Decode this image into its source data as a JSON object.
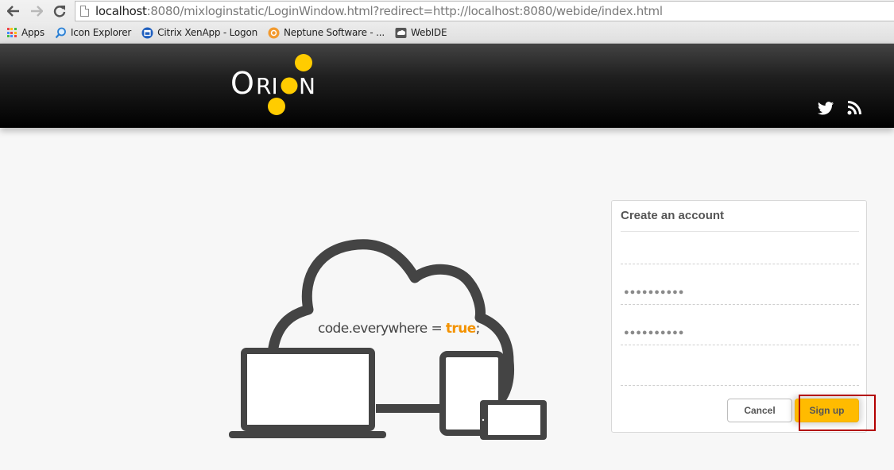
{
  "browser": {
    "url_host": "localhost",
    "url_rest": ":8080/mixloginstatic/LoginWindow.html?redirect=http://localhost:8080/webide/index.html",
    "bookmarks": [
      {
        "label": "Apps",
        "icon": "apps-grid-icon"
      },
      {
        "label": "Icon Explorer",
        "icon": "magnifier-icon"
      },
      {
        "label": "Citrix XenApp - Logon",
        "icon": "citrix-icon"
      },
      {
        "label": "Neptune Software - ...",
        "icon": "neptune-icon"
      },
      {
        "label": "WebIDE",
        "icon": "webide-icon"
      }
    ]
  },
  "header": {
    "logo_text": "ORION",
    "social": [
      "twitter-icon",
      "rss-icon"
    ],
    "colors": {
      "accent": "#ffcc00"
    }
  },
  "illustration": {
    "tagline_code": "code.everywhere = ",
    "tagline_keyword": "true",
    "tagline_end": ";",
    "keyword_color": "#f39200"
  },
  "signup": {
    "title": "Create an account",
    "fields": [
      {
        "name": "username",
        "value": "",
        "placeholder": ""
      },
      {
        "name": "password",
        "value": "●●●●●●●●●●"
      },
      {
        "name": "password-confirm",
        "value": "●●●●●●●●●●"
      },
      {
        "name": "email",
        "value": "",
        "placeholder": ""
      }
    ],
    "cancel_label": "Cancel",
    "signup_label": "Sign up",
    "signup_color": "#ffbb00"
  }
}
